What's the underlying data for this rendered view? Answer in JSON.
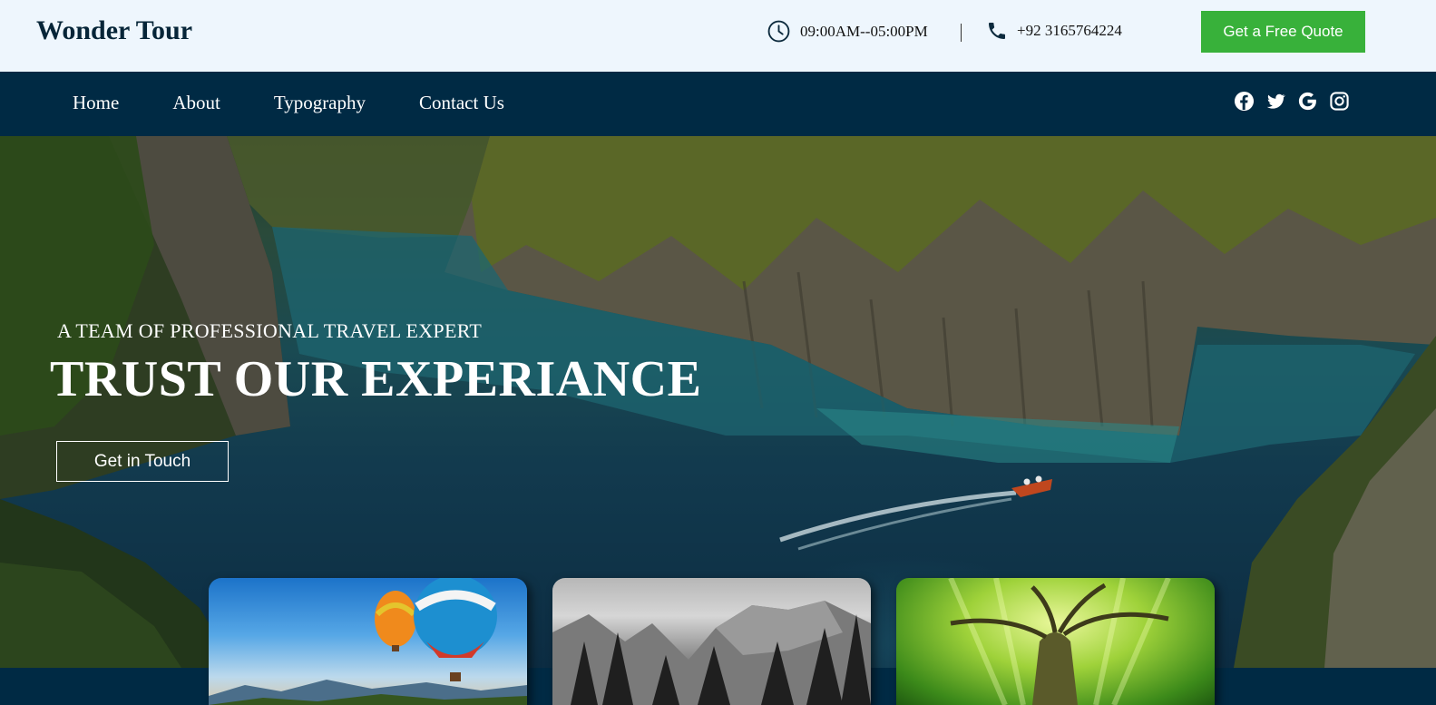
{
  "brand": {
    "name": "Wonder Tour"
  },
  "header": {
    "hours": "09:00AM--05:00PM",
    "phone": "+92 3165764224",
    "quote_button": "Get a Free Quote"
  },
  "nav": {
    "links": [
      "Home",
      "About",
      "Typography",
      "Contact Us"
    ],
    "socials": [
      "facebook-icon",
      "twitter-icon",
      "google-icon",
      "instagram-icon"
    ]
  },
  "hero": {
    "subtitle": "A TEAM OF PROFESSIONAL TRAVEL EXPERT",
    "title": "TRUST OUR EXPERIANCE",
    "cta": "Get in Touch"
  },
  "cards": [
    "hot-air-balloons-image",
    "mountain-forest-image",
    "green-tree-image"
  ],
  "colors": {
    "topbar_bg": "#eef6fd",
    "nav_bg": "#002a44",
    "accent_green": "#38b13a",
    "text_dark": "#062538"
  }
}
